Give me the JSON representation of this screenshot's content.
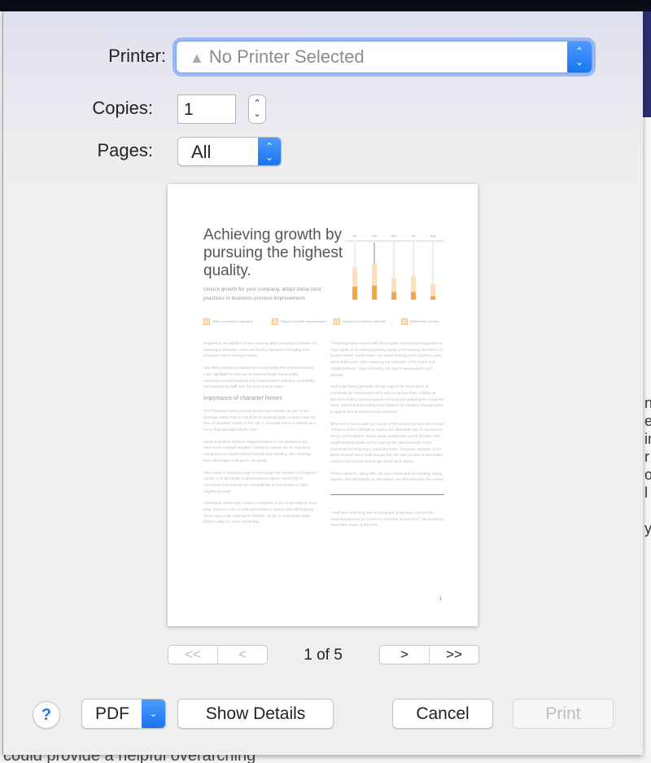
{
  "dialog": {
    "printer_label": "Printer:",
    "printer_value": "No Printer Selected",
    "printer_warning_icon": "warning-triangle-icon",
    "copies_label": "Copies:",
    "copies_value": "1",
    "pages_label": "Pages:",
    "pages_value": "All"
  },
  "preview": {
    "title": "Achieving growth by pursuing the highest quality.",
    "subtitle": "Unlock growth for your company, adopt these best practices in business process improvement.",
    "legend": [
      "Rate increased to intervalue",
      "Ready to benefit representation",
      "Introduction retention benefits",
      "Refinement via lead"
    ],
    "chart_columns": [
      "Jan",
      "Feb",
      "Mar",
      "Apr",
      "May"
    ],
    "chart_values_light": [
      55,
      62,
      37,
      41,
      27
    ],
    "chart_values_dark": [
      22,
      24,
      13,
      13,
      6
    ],
    "left_column": {
      "p1": "Supporting the addition of new housing while providing incentives for retaining a character home are the key directions emerging from Character Home Zoning Review.",
      "p2": "City staff provided an update to Council today that summarized the main highlights of what we've heard through recent public consultations and feedback from stakeholders, industry consultants, and analysis by staff over the past several years.",
      "heading": "Importance of character homes",
      "p3": "The Character Home Zoning Review was initiated as part of our Heritage Action Plan in response to growing public concern over the loss of character homes in the city. A character home is defined as a home that was built before 1940.",
      "p4": "Meets extension refers to original features is not retained in the Vancouver Heritage Register. Character homes are an important component of neighbourhood identity and vibrancy, and retaining them also helps meet green city goals.",
      "p5": "The review is exploring ways to encourage the retention of character homes in single-family neighbourhoods (areas zoned RS) in Vancouver and improve the compatibility of new homes in older neighbourhoods.",
      "p6": "Allowing an owner who retains a character home to increase its floor area. Convert it into a multi-unit residence and/or add infill housing. These new units could be for families, rental, or potentially strata titled to allow for home ownership."
    },
    "right_column": {
      "p1": "\"Providing home owners with these types of incentives supports the City's goals of increasing housing supply and reducing demolition of livable homes. It will create new rental housing units, possibly more strata-titled units, while retaining the character of the home and neighbourhood,\" says Gil Kelley, the City of Vancouver's chief planner.",
      "p2": "Staff have heard generally strong support for these kinds of incentives for homeowners who wish to pursue them. Additional directions being explored include refining and updating the character home criteria and providing more support for retention through grant programs and processing improvements.",
      "p3": "What we've heard over the course of the review, we have also heard concerns some consider to reduce the allowable size of new homes being constructed in certain areas so that they would fit better with neighbourhood scale and to improve the attractiveness of the incentives for retaining a character home. Economic analysis of the ideas showed that it could impact the size and number of secondary suites in new homes and single-family land values.",
      "p4": "These concerns, along with city-wide issues around housing supply, options, and affordability in Vancouver, are also informing the review.",
      "footnote": "¹ Staff are continuing their analysis and preparing a report with recommendations for Council to consider in April 2017. No decisions have been made at this time."
    },
    "page_number": "1"
  },
  "pagination": {
    "first_label": "<<",
    "prev_label": "<",
    "indicator": "1 of 5",
    "next_label": ">",
    "last_label": ">>"
  },
  "footer": {
    "help_label": "?",
    "pdf_label": "PDF",
    "show_details_label": "Show Details",
    "cancel_label": "Cancel",
    "print_label": "Print"
  },
  "background": {
    "right_edge_glyphs": "n\nec\nin\nr\nol\nl\n\ny",
    "bottom_text": "could provide a helpful overarching"
  },
  "colors": {
    "accent_blue": "#1a74f0",
    "chart_orange": "#f2a64a",
    "chart_orange_light": "#fde0bd"
  }
}
